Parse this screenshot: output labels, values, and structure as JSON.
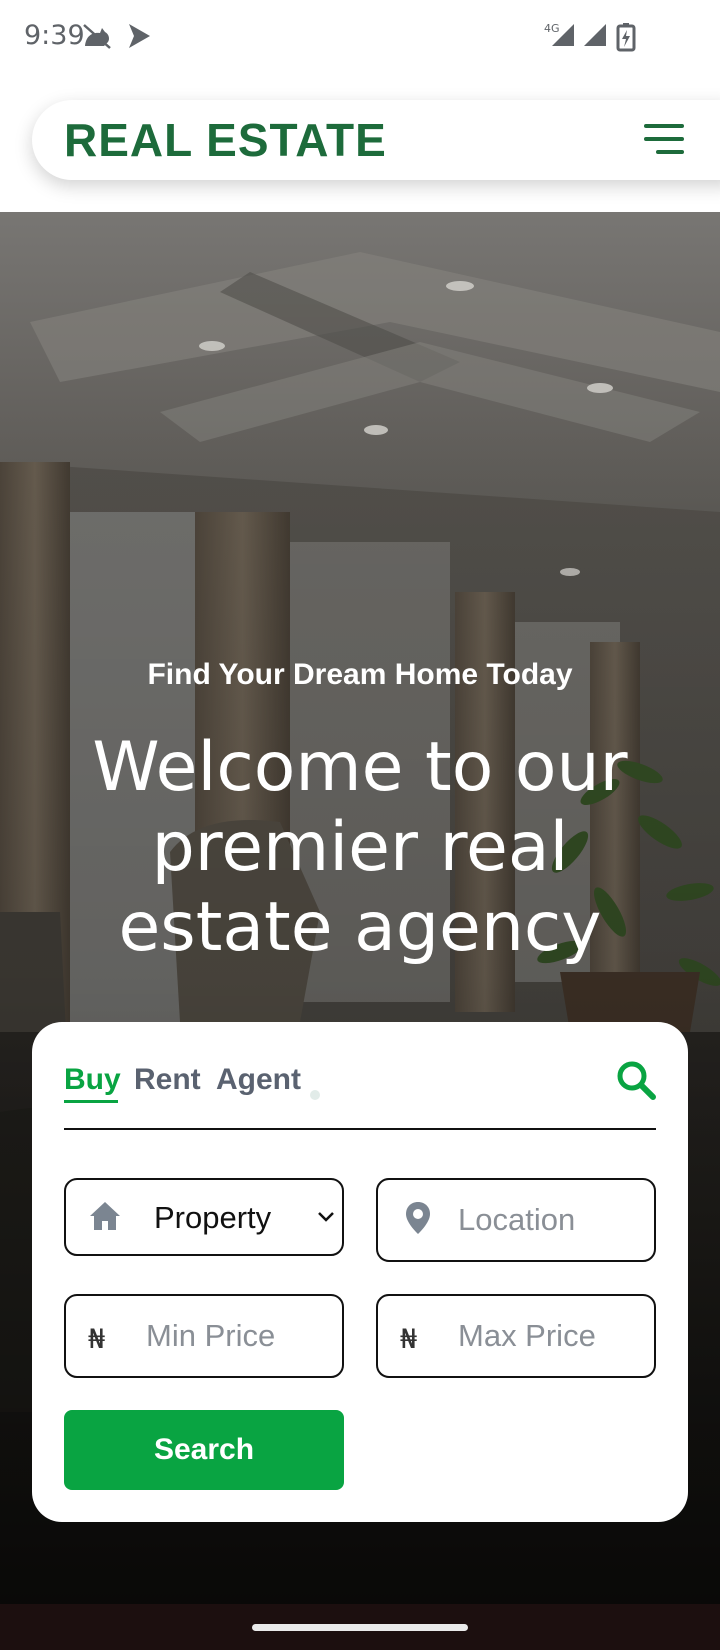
{
  "status_bar": {
    "time": "9:39",
    "network_label": "4G",
    "icons": [
      "cat-notification-icon",
      "play-store-icon",
      "signal-4g-icon",
      "signal-icon",
      "battery-charging-icon"
    ]
  },
  "header": {
    "brand": "REAL ESTATE",
    "menu_icon": "hamburger-menu-icon",
    "brand_color": "#1d6b3b"
  },
  "hero": {
    "tagline": "Find Your Dream Home Today",
    "headline": "Welcome to our premier real estate agency"
  },
  "search_card": {
    "tabs": [
      {
        "label": "Buy",
        "active": true
      },
      {
        "label": "Rent",
        "active": false
      },
      {
        "label": "Agent",
        "active": false
      }
    ],
    "search_icon": "search-icon",
    "property_select": {
      "value": "Property",
      "icon": "home-icon"
    },
    "location_input": {
      "placeholder": "Location",
      "icon": "map-pin-icon"
    },
    "min_price_input": {
      "placeholder": "Min Price",
      "currency": "₦"
    },
    "max_price_input": {
      "placeholder": "Max Price",
      "currency": "₦"
    },
    "submit_label": "Search",
    "accent_color": "#09a442"
  }
}
